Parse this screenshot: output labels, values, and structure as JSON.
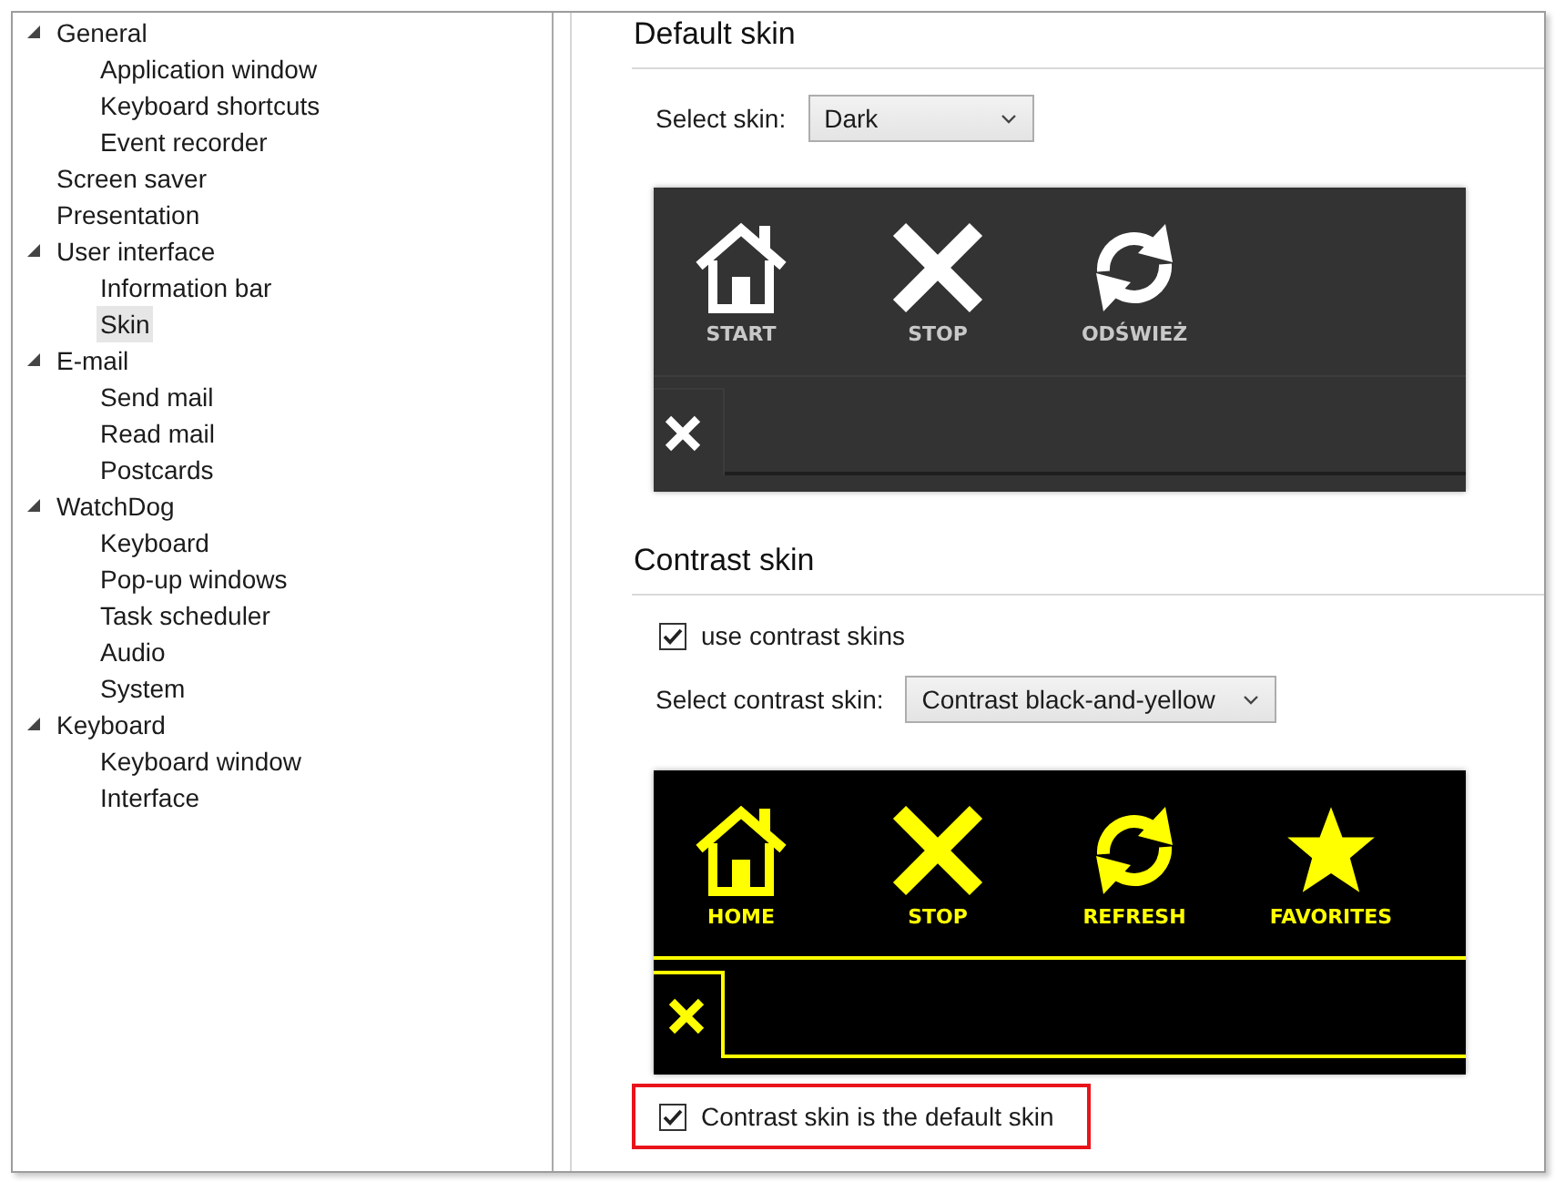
{
  "tree": [
    {
      "label": "General",
      "expanded": true,
      "selected": false,
      "children": [
        {
          "label": "Application window",
          "selected": false
        },
        {
          "label": "Keyboard shortcuts",
          "selected": false
        },
        {
          "label": "Event recorder",
          "selected": false
        }
      ]
    },
    {
      "label": "Screen saver",
      "selected": false
    },
    {
      "label": "Presentation",
      "selected": false
    },
    {
      "label": "User interface",
      "expanded": true,
      "selected": false,
      "children": [
        {
          "label": "Information bar",
          "selected": false
        },
        {
          "label": "Skin",
          "selected": true
        }
      ]
    },
    {
      "label": "E-mail",
      "expanded": true,
      "selected": false,
      "children": [
        {
          "label": "Send mail",
          "selected": false
        },
        {
          "label": "Read mail",
          "selected": false
        },
        {
          "label": "Postcards",
          "selected": false
        }
      ]
    },
    {
      "label": "WatchDog",
      "expanded": true,
      "selected": false,
      "children": [
        {
          "label": "Keyboard",
          "selected": false
        },
        {
          "label": "Pop-up windows",
          "selected": false
        },
        {
          "label": "Task scheduler",
          "selected": false
        },
        {
          "label": "Audio",
          "selected": false
        },
        {
          "label": "System",
          "selected": false
        }
      ]
    },
    {
      "label": "Keyboard",
      "expanded": true,
      "selected": false,
      "children": [
        {
          "label": "Keyboard window",
          "selected": false
        },
        {
          "label": "Interface",
          "selected": false
        }
      ]
    }
  ],
  "default_skin": {
    "heading": "Default skin",
    "select_label": "Select skin:",
    "select_value": "Dark",
    "preview": {
      "kind": "dark",
      "toolbar": [
        {
          "kind": "home",
          "label": "START"
        },
        {
          "kind": "stop",
          "label": "STOP"
        },
        {
          "kind": "refresh",
          "label": "ODŚWIEŻ"
        }
      ]
    }
  },
  "contrast_skin": {
    "heading": "Contrast skin",
    "use_option": {
      "label": "use contrast skins",
      "checked": true
    },
    "select_label": "Select contrast skin:",
    "select_value": "Contrast black-and-yellow",
    "preview": {
      "kind": "contrast",
      "toolbar": [
        {
          "kind": "home",
          "label": "HOME"
        },
        {
          "kind": "stop",
          "label": "STOP"
        },
        {
          "kind": "refresh",
          "label": "REFRESH"
        },
        {
          "kind": "star",
          "label": "FAVORITES"
        }
      ]
    },
    "default_option": {
      "label": "Contrast skin is the default skin",
      "checked": true,
      "highlighted": true
    }
  }
}
